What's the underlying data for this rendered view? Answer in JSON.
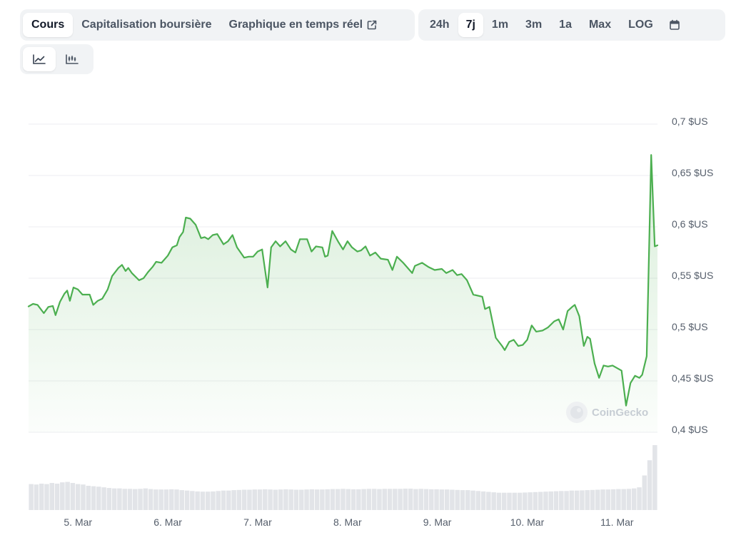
{
  "tabs": {
    "price": "Cours",
    "market_cap": "Capitalisation boursière",
    "live_chart": "Graphique en temps réel"
  },
  "ranges": [
    "24h",
    "7j",
    "1m",
    "3m",
    "1a",
    "Max",
    "LOG"
  ],
  "active_range": "7j",
  "watermark": "CoinGecko",
  "icons": {
    "external": "external-link-icon",
    "calendar": "calendar-icon",
    "line": "line-chart-icon",
    "candles": "candlestick-chart-icon"
  },
  "colors": {
    "line": "#4caf50",
    "fill": "#4caf50",
    "volume": "#e2e4e8",
    "grid": "#eceef1"
  },
  "chart_data": {
    "type": "area",
    "title": "",
    "xlabel": "",
    "ylabel": "",
    "ylim": [
      0.4,
      0.7
    ],
    "y_ticks": [
      "0,7 $US",
      "0,65 $US",
      "0,6 $US",
      "0,55 $US",
      "0,5 $US",
      "0,45 $US",
      "0,4 $US"
    ],
    "y_tick_values": [
      0.7,
      0.65,
      0.6,
      0.55,
      0.5,
      0.45,
      0.4
    ],
    "x_ticks": [
      "5. Mar",
      "6. Mar",
      "7. Mar",
      "8. Mar",
      "9. Mar",
      "10. Mar",
      "11. Mar"
    ],
    "x_tick_values": [
      0.55,
      1.55,
      2.55,
      3.55,
      4.55,
      5.55,
      6.55
    ],
    "xlim": [
      0,
      7
    ],
    "grid": true,
    "series": [
      {
        "values": [
          [
            0,
            0.5225
          ],
          [
            0.05,
            0.525
          ],
          [
            0.1,
            0.524
          ],
          [
            0.17,
            0.516
          ],
          [
            0.22,
            0.522
          ],
          [
            0.27,
            0.523
          ],
          [
            0.3,
            0.514
          ],
          [
            0.35,
            0.527
          ],
          [
            0.4,
            0.535
          ],
          [
            0.43,
            0.538
          ],
          [
            0.46,
            0.528
          ],
          [
            0.5,
            0.541
          ],
          [
            0.55,
            0.539
          ],
          [
            0.6,
            0.534
          ],
          [
            0.68,
            0.534
          ],
          [
            0.72,
            0.524
          ],
          [
            0.77,
            0.528
          ],
          [
            0.82,
            0.53
          ],
          [
            0.88,
            0.539
          ],
          [
            0.93,
            0.552
          ],
          [
            1.0,
            0.56
          ],
          [
            1.04,
            0.563
          ],
          [
            1.08,
            0.557
          ],
          [
            1.11,
            0.56
          ],
          [
            1.15,
            0.555
          ],
          [
            1.23,
            0.548
          ],
          [
            1.28,
            0.55
          ],
          [
            1.33,
            0.556
          ],
          [
            1.38,
            0.561
          ],
          [
            1.42,
            0.566
          ],
          [
            1.48,
            0.565
          ],
          [
            1.55,
            0.572
          ],
          [
            1.6,
            0.58
          ],
          [
            1.65,
            0.582
          ],
          [
            1.68,
            0.59
          ],
          [
            1.72,
            0.595
          ],
          [
            1.75,
            0.609
          ],
          [
            1.8,
            0.608
          ],
          [
            1.86,
            0.602
          ],
          [
            1.92,
            0.589
          ],
          [
            1.96,
            0.59
          ],
          [
            2.0,
            0.588
          ],
          [
            2.05,
            0.592
          ],
          [
            2.1,
            0.593
          ],
          [
            2.17,
            0.583
          ],
          [
            2.22,
            0.586
          ],
          [
            2.27,
            0.592
          ],
          [
            2.32,
            0.58
          ],
          [
            2.4,
            0.57
          ],
          [
            2.45,
            0.571
          ],
          [
            2.5,
            0.571
          ],
          [
            2.55,
            0.576
          ],
          [
            2.6,
            0.578
          ],
          [
            2.66,
            0.541
          ],
          [
            2.7,
            0.58
          ],
          [
            2.75,
            0.586
          ],
          [
            2.8,
            0.581
          ],
          [
            2.86,
            0.586
          ],
          [
            2.92,
            0.578
          ],
          [
            2.97,
            0.575
          ],
          [
            3.02,
            0.588
          ],
          [
            3.1,
            0.588
          ],
          [
            3.15,
            0.576
          ],
          [
            3.2,
            0.581
          ],
          [
            3.27,
            0.58
          ],
          [
            3.3,
            0.571
          ],
          [
            3.33,
            0.572
          ],
          [
            3.38,
            0.596
          ],
          [
            3.45,
            0.585
          ],
          [
            3.5,
            0.578
          ],
          [
            3.55,
            0.586
          ],
          [
            3.6,
            0.58
          ],
          [
            3.66,
            0.576
          ],
          [
            3.7,
            0.577
          ],
          [
            3.75,
            0.581
          ],
          [
            3.8,
            0.572
          ],
          [
            3.86,
            0.575
          ],
          [
            3.92,
            0.569
          ],
          [
            4.0,
            0.568
          ],
          [
            4.05,
            0.558
          ],
          [
            4.1,
            0.571
          ],
          [
            4.17,
            0.565
          ],
          [
            4.27,
            0.555
          ],
          [
            4.3,
            0.562
          ],
          [
            4.38,
            0.565
          ],
          [
            4.45,
            0.561
          ],
          [
            4.52,
            0.558
          ],
          [
            4.6,
            0.559
          ],
          [
            4.65,
            0.555
          ],
          [
            4.72,
            0.558
          ],
          [
            4.77,
            0.553
          ],
          [
            4.82,
            0.554
          ],
          [
            4.88,
            0.548
          ],
          [
            4.95,
            0.534
          ],
          [
            5.05,
            0.532
          ],
          [
            5.08,
            0.52
          ],
          [
            5.13,
            0.522
          ],
          [
            5.2,
            0.492
          ],
          [
            5.27,
            0.484
          ],
          [
            5.3,
            0.48
          ],
          [
            5.35,
            0.488
          ],
          [
            5.4,
            0.49
          ],
          [
            5.45,
            0.484
          ],
          [
            5.5,
            0.485
          ],
          [
            5.55,
            0.49
          ],
          [
            5.6,
            0.504
          ],
          [
            5.65,
            0.498
          ],
          [
            5.72,
            0.499
          ],
          [
            5.78,
            0.502
          ],
          [
            5.85,
            0.508
          ],
          [
            5.9,
            0.51
          ],
          [
            5.95,
            0.5
          ],
          [
            6.0,
            0.518
          ],
          [
            6.05,
            0.522
          ],
          [
            6.08,
            0.524
          ],
          [
            6.13,
            0.513
          ],
          [
            6.18,
            0.484
          ],
          [
            6.22,
            0.493
          ],
          [
            6.25,
            0.491
          ],
          [
            6.3,
            0.467
          ],
          [
            6.35,
            0.453
          ],
          [
            6.4,
            0.465
          ],
          [
            6.45,
            0.464
          ],
          [
            6.5,
            0.465
          ],
          [
            6.6,
            0.46
          ],
          [
            6.65,
            0.426
          ],
          [
            6.7,
            0.448
          ],
          [
            6.75,
            0.455
          ],
          [
            6.8,
            0.453
          ],
          [
            6.83,
            0.456
          ],
          [
            6.88,
            0.474
          ],
          [
            6.93,
            0.67
          ],
          [
            6.97,
            0.581
          ],
          [
            7.0,
            0.582
          ]
        ]
      }
    ],
    "volume": [
      1.2,
      1.18,
      1.22,
      1.2,
      1.25,
      1.22,
      1.28,
      1.3,
      1.25,
      1.2,
      1.18,
      1.12,
      1.1,
      1.08,
      1.05,
      1.02,
      1.0,
      1.0,
      0.98,
      0.98,
      0.97,
      0.98,
      1.0,
      0.97,
      0.95,
      0.95,
      0.95,
      0.96,
      0.95,
      0.92,
      0.9,
      0.88,
      0.86,
      0.85,
      0.85,
      0.86,
      0.88,
      0.9,
      0.9,
      0.92,
      0.93,
      0.94,
      0.94,
      0.95,
      0.95,
      0.96,
      0.95,
      0.94,
      0.95,
      0.96,
      0.95,
      0.94,
      0.94,
      0.95,
      0.96,
      0.95,
      0.95,
      0.96,
      0.97,
      0.97,
      0.98,
      0.97,
      0.96,
      0.96,
      0.97,
      0.98,
      0.98,
      0.97,
      0.98,
      0.98,
      0.98,
      0.98,
      0.99,
      0.99,
      0.97,
      0.98,
      0.97,
      0.96,
      0.96,
      0.95,
      0.95,
      0.94,
      0.93,
      0.92,
      0.92,
      0.9,
      0.88,
      0.86,
      0.84,
      0.82,
      0.8,
      0.8,
      0.8,
      0.8,
      0.8,
      0.81,
      0.82,
      0.83,
      0.84,
      0.85,
      0.86,
      0.87,
      0.88,
      0.88,
      0.9,
      0.9,
      0.91,
      0.92,
      0.93,
      0.94,
      0.95,
      0.95,
      0.96,
      0.97,
      0.97,
      0.98,
      1.0,
      1.05,
      1.6,
      2.3,
      3.0
    ],
    "volume_axis": false
  }
}
